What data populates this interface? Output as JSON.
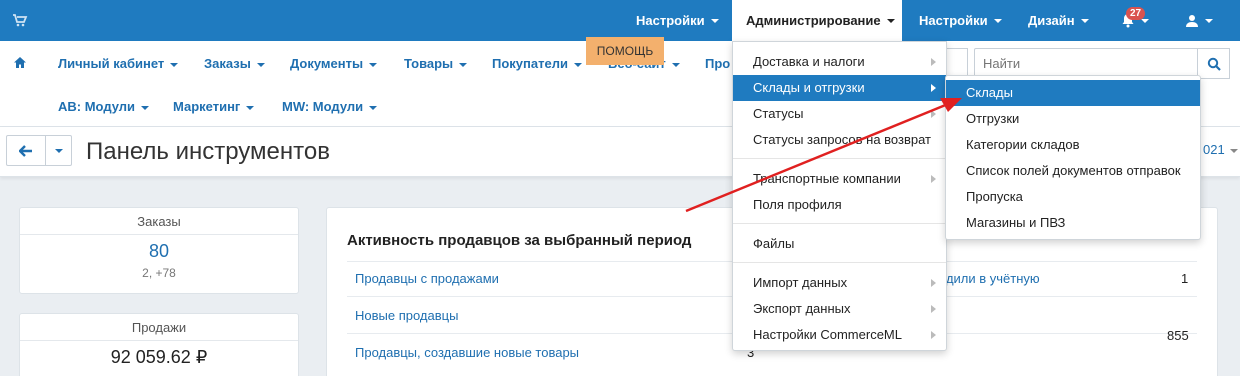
{
  "topbar": {
    "settings_left": "Настройки",
    "administration": "Администрирование",
    "settings_right": "Настройки",
    "design": "Дизайн",
    "notifications_count": "27"
  },
  "nav2": {
    "items": [
      "Личный кабинет",
      "Заказы",
      "Документы",
      "Товары",
      "Покупатели",
      "Веб-сайт",
      "Про"
    ],
    "row2": [
      "AB: Модули",
      "Маркетинг",
      "MW: Модули"
    ],
    "search_placeholder": "Найти"
  },
  "toolbar": {
    "page_title": "Панель инструментов",
    "help": "ПОМОЩЬ",
    "year_fragment": "021"
  },
  "cards": {
    "orders_label": "Заказы",
    "orders_value": "80",
    "orders_sub": "2, +78",
    "sales_label": "Продажи",
    "sales_value": "92 059.62 ₽"
  },
  "panel": {
    "title": "Активность продавцов за выбранный период",
    "rows": [
      {
        "label": "Продавцы с продажами",
        "right_fragment": "одили в учётную",
        "value": "1"
      },
      {
        "label": "Новые продавцы",
        "value": ""
      },
      {
        "label": "Продавцы, создавшие новые товары",
        "left_value_fragment": "3",
        "value": "855"
      }
    ]
  },
  "dropdown": {
    "items": [
      {
        "label": "Доставка и налоги",
        "arrow": true
      },
      {
        "label": "Склады и отгрузки",
        "arrow": true,
        "active": true
      },
      {
        "label": "Статусы",
        "arrow": true
      },
      {
        "label": "Статусы запросов на возврат",
        "arrow": false
      },
      {
        "label": "Транспортные компании",
        "arrow": true
      },
      {
        "label": "Поля профиля",
        "arrow": false
      },
      {
        "label": "Файлы",
        "arrow": false
      },
      {
        "label": "Импорт данных",
        "arrow": true
      },
      {
        "label": "Экспорт данных",
        "arrow": true
      },
      {
        "label": "Настройки CommerceML",
        "arrow": true
      }
    ]
  },
  "submenu": {
    "items": [
      "Склады",
      "Отгрузки",
      "Категории складов",
      "Список полей документов отправок",
      "Пропуска",
      "Магазины и ПВЗ"
    ]
  },
  "colors": {
    "brand_blue": "#1f7bc0",
    "link_blue": "#1f6fb0",
    "help_orange": "#f3b06d",
    "annotation_red": "#e02020",
    "badge_red": "#d9534f"
  }
}
